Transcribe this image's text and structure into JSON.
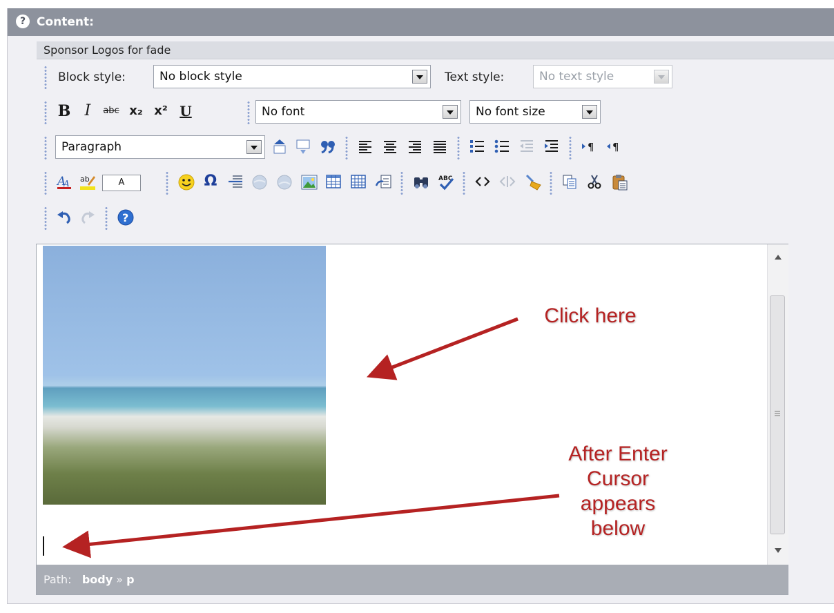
{
  "header": {
    "help_glyph": "?",
    "title": "Content:"
  },
  "field_label": "Sponsor Logos for fade",
  "toolbar": {
    "block_style_label": "Block style:",
    "block_style_value": "No block style",
    "text_style_label": "Text style:",
    "text_style_value": "No text style",
    "bold_label": "B",
    "italic_label": "I",
    "strike_label": "abc",
    "sub_label": "x₂",
    "sup_label": "x²",
    "underline_label": "U",
    "font_value": "No font",
    "font_size_value": "No font size",
    "format_value": "Paragraph",
    "char_label": "A",
    "omega_label": "Ω"
  },
  "editor": {
    "image_alt": "beach image",
    "path_label": "Path:",
    "path_body": "body",
    "path_sep": "»",
    "path_p": "p"
  },
  "annotations": {
    "click_here": "Click here",
    "after_enter_line1": "After Enter",
    "after_enter_line2": "Cursor",
    "after_enter_line3": "appears",
    "after_enter_line4": "below"
  },
  "colors": {
    "header_bg": "#8d929d",
    "annotation_red": "#b52222",
    "path_bar_bg": "#a9adb5"
  }
}
